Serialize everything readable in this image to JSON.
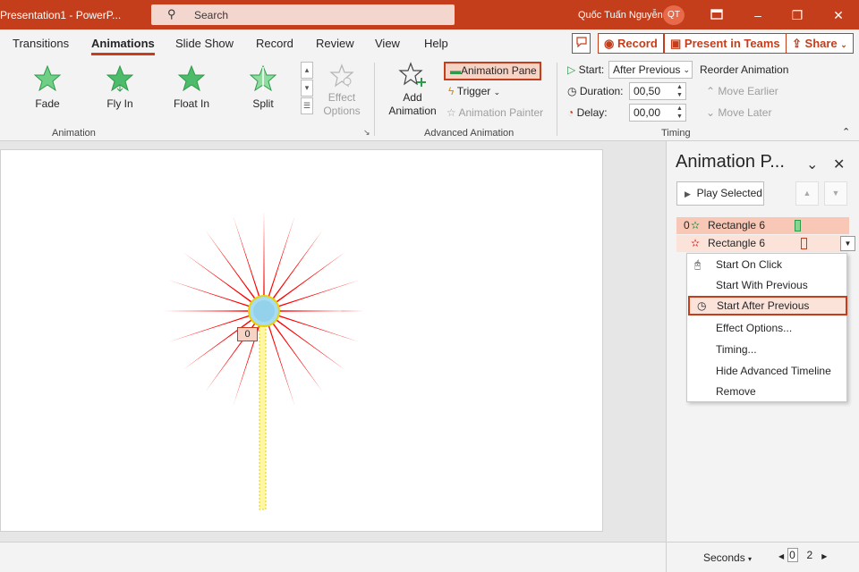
{
  "titlebar": {
    "app_title": "Presentation1 - PowerP...",
    "search_placeholder": "Search",
    "user_name": "Quốc Tuấn Nguyễn",
    "avatar_initials": "QT",
    "ribbon_display_icon": "ribbon-display-icon",
    "minimize": "–",
    "restore": "❐",
    "close": "✕",
    "bg_color": "#c43e1c"
  },
  "tabs": [
    {
      "label": "Transitions"
    },
    {
      "label": "Animations",
      "active": true
    },
    {
      "label": "Slide Show"
    },
    {
      "label": "Record"
    },
    {
      "label": "Review"
    },
    {
      "label": "View"
    },
    {
      "label": "Help"
    }
  ],
  "quick_buttons": {
    "comment_icon": "comment-icon",
    "record": "Record",
    "present": "Present in Teams",
    "share": "Share"
  },
  "animation_gallery": {
    "items": [
      "Fade",
      "Fly In",
      "Float In",
      "Split"
    ],
    "effect_options": "Effect Options",
    "group_label": "Animation"
  },
  "advanced_animation": {
    "add_animation": "Add Animation",
    "animation_pane": "Animation Pane",
    "trigger": "Trigger",
    "animation_painter": "Animation Painter",
    "group_label": "Advanced Animation"
  },
  "timing": {
    "start_label": "Start:",
    "start_value": "After Previous",
    "duration_label": "Duration:",
    "duration_value": "00,50",
    "delay_label": "Delay:",
    "delay_value": "00,00",
    "reorder": "Reorder Animation",
    "move_earlier": "Move Earlier",
    "move_later": "Move Later",
    "group_label": "Timing"
  },
  "slide": {
    "tag": "0",
    "ray_count": 20,
    "ray_color": "#ff0000"
  },
  "pane": {
    "title": "Animation P...",
    "play_selected": "Play Selected",
    "rows": [
      {
        "index": "0",
        "name": "Rectangle 6",
        "icon": "green-star-icon"
      },
      {
        "index": "",
        "name": "Rectangle 6",
        "icon": "red-star-icon"
      }
    ]
  },
  "context_menu": {
    "items": [
      {
        "label": "Start On Click",
        "icon": "mouse-icon"
      },
      {
        "label": "Start With Previous",
        "icon": ""
      },
      {
        "label": "Start After Previous",
        "icon": "clock-icon",
        "highlighted": true
      },
      {
        "label": "Effect Options...",
        "icon": ""
      },
      {
        "label": "Timing...",
        "icon": ""
      },
      {
        "label": "Hide Advanced Timeline",
        "icon": ""
      },
      {
        "label": "Remove",
        "icon": ""
      }
    ]
  },
  "footer": {
    "seconds": "Seconds",
    "ruler_start": "0",
    "ruler_end": "2"
  }
}
